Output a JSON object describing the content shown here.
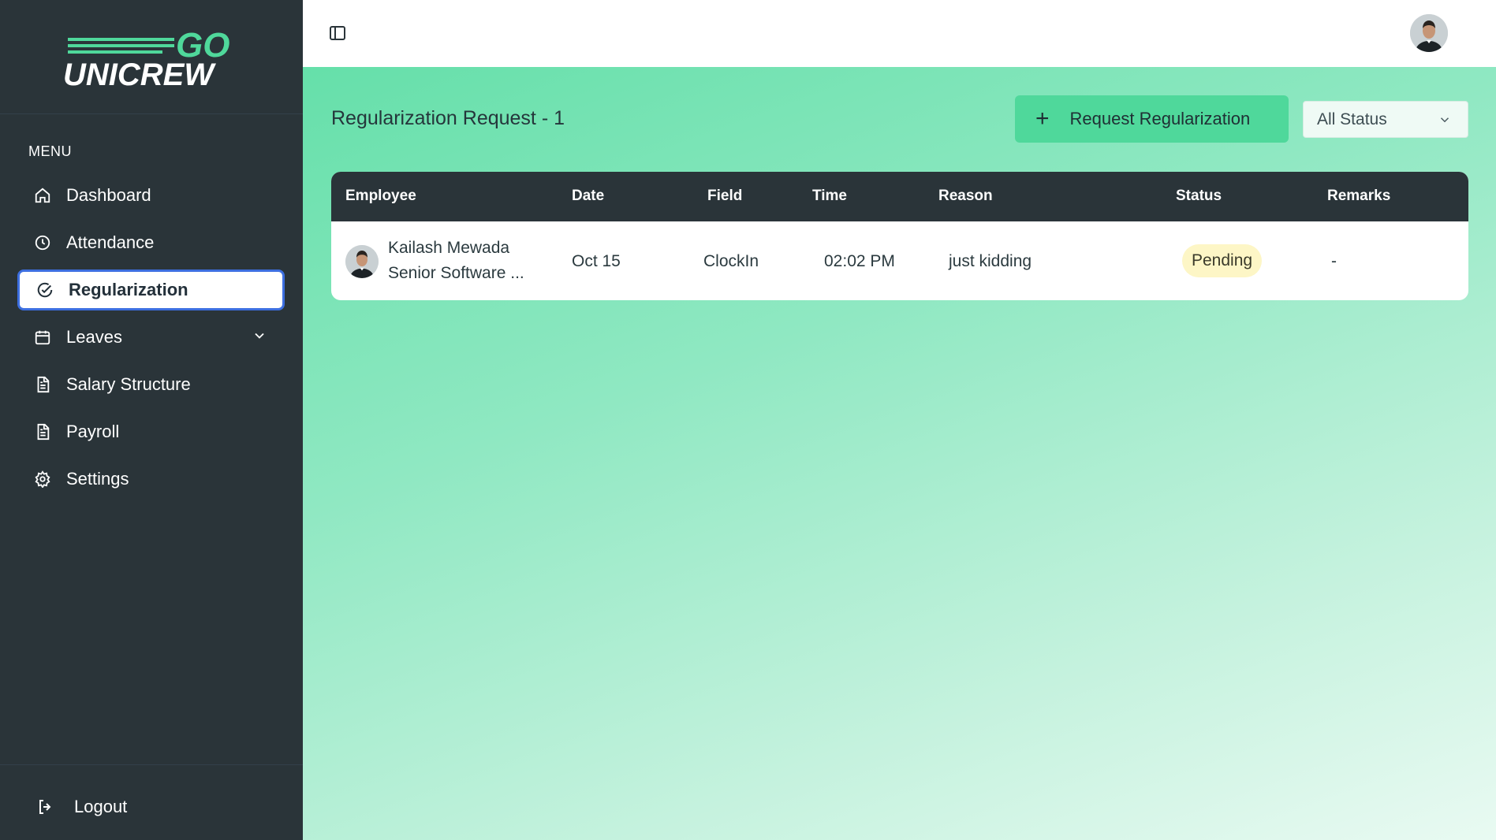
{
  "brand": {
    "logo_go": "GO",
    "logo_name": "UNICREW",
    "accent": "#4fd89b"
  },
  "sidebar": {
    "menu_heading": "MENU",
    "items": [
      {
        "label": "Dashboard",
        "icon": "home-icon"
      },
      {
        "label": "Attendance",
        "icon": "clock-icon"
      },
      {
        "label": "Regularization",
        "icon": "check-circle-icon",
        "active": true
      },
      {
        "label": "Leaves",
        "icon": "calendar-icon",
        "expandable": true
      },
      {
        "label": "Salary Structure",
        "icon": "document-icon"
      },
      {
        "label": "Payroll",
        "icon": "document-icon"
      },
      {
        "label": "Settings",
        "icon": "gear-icon"
      }
    ],
    "logout_label": "Logout"
  },
  "header": {
    "page_title": "Regularization Request - 1",
    "request_button": "Request Regularization",
    "status_filter": "All Status"
  },
  "table": {
    "columns": [
      "Employee",
      "Date",
      "Field",
      "Time",
      "Reason",
      "Status",
      "Remarks"
    ],
    "rows": [
      {
        "employee_name": "Kailash Mewada",
        "employee_role": "Senior Software ...",
        "date": "Oct 15",
        "field": "ClockIn",
        "time": "02:02 PM",
        "reason": "just kidding",
        "status": "Pending",
        "remarks": "-"
      }
    ]
  }
}
